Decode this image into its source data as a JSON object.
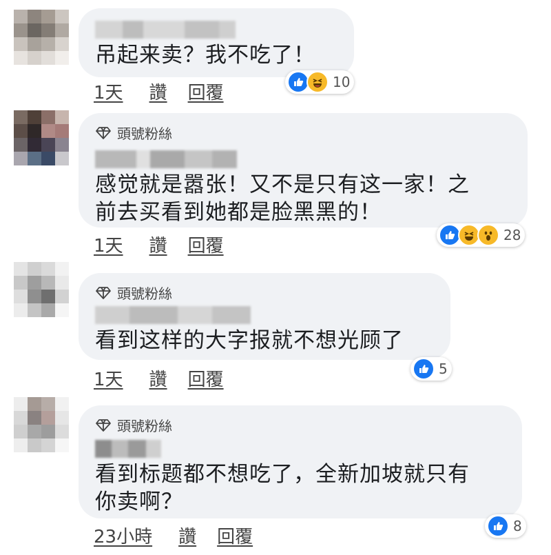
{
  "comments": [
    {
      "badge": "",
      "text": "吊起来卖？我不吃了！",
      "time": "1天",
      "like_label": "讚",
      "reply_label": "回覆",
      "reactions": [
        "like",
        "haha"
      ],
      "reaction_count": "10"
    },
    {
      "badge": "頭號粉絲",
      "text": "感觉就是嚣张！又不是只有这一家！之\n前去买看到她都是脸黑黑的！",
      "time": "1天",
      "like_label": "讚",
      "reply_label": "回覆",
      "reactions": [
        "like",
        "haha",
        "wow"
      ],
      "reaction_count": "28"
    },
    {
      "badge": "頭號粉絲",
      "text": "看到这样的大字报就不想光顾了",
      "time": "1天",
      "like_label": "讚",
      "reply_label": "回覆",
      "reactions": [
        "like"
      ],
      "reaction_count": "5"
    },
    {
      "badge": "頭號粉絲",
      "text": "看到标题都不想吃了，全新加坡就只有\n你卖啊？",
      "time": "23小時",
      "like_label": "讚",
      "reply_label": "回覆",
      "reactions": [
        "like"
      ],
      "reaction_count": "8"
    }
  ],
  "colors": {
    "like_blue": "#1877f2",
    "haha_yellow": "#f7b928",
    "bubble_bg": "#f0f2f5"
  }
}
